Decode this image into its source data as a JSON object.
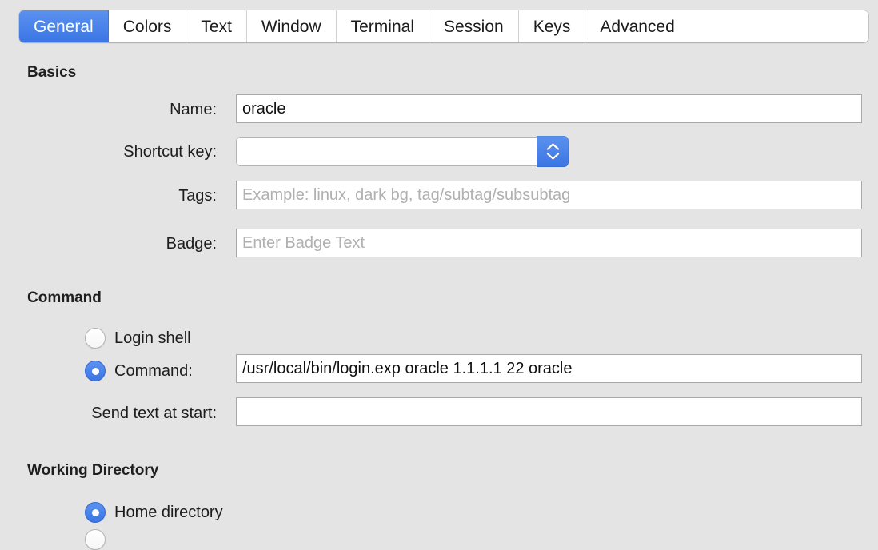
{
  "tabs": [
    {
      "label": "General",
      "selected": true
    },
    {
      "label": "Colors",
      "selected": false
    },
    {
      "label": "Text",
      "selected": false
    },
    {
      "label": "Window",
      "selected": false
    },
    {
      "label": "Terminal",
      "selected": false
    },
    {
      "label": "Session",
      "selected": false
    },
    {
      "label": "Keys",
      "selected": false
    },
    {
      "label": "Advanced",
      "selected": false
    }
  ],
  "basics": {
    "heading": "Basics",
    "name": {
      "label": "Name:",
      "value": "oracle"
    },
    "shortcut_key": {
      "label": "Shortcut key:",
      "value": "",
      "stepper_icon": "stepper-up-down-icon"
    },
    "tags": {
      "label": "Tags:",
      "value": "",
      "placeholder": "Example: linux, dark bg, tag/subtag/subsubtag"
    },
    "badge": {
      "label": "Badge:",
      "value": "",
      "placeholder": "Enter Badge Text"
    }
  },
  "command": {
    "heading": "Command",
    "login_shell": {
      "label": "Login shell",
      "selected": false
    },
    "command": {
      "label": "Command:",
      "selected": true,
      "value": "/usr/local/bin/login.exp oracle 1.1.1.1 22 oracle"
    },
    "send_text": {
      "label": "Send text at start:",
      "value": ""
    }
  },
  "working_directory": {
    "heading": "Working Directory",
    "home": {
      "label": "Home directory",
      "selected": true
    }
  },
  "colors": {
    "accent": "#3b75e4",
    "accent_light": "#5b92ef",
    "background": "#e4e4e4",
    "field_background": "#ffffff",
    "text": "#1d1d1d",
    "placeholder": "#b0b0b0"
  }
}
